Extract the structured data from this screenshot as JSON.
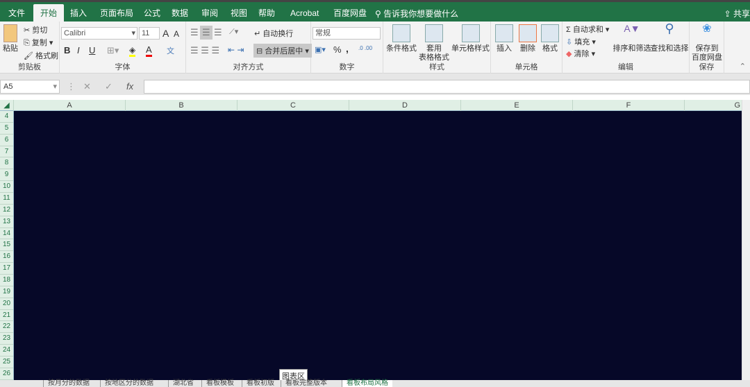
{
  "menu_tabs": [
    "文件",
    "开始",
    "插入",
    "页面布局",
    "公式",
    "数据",
    "审阅",
    "视图",
    "帮助",
    "Acrobat",
    "百度网盘"
  ],
  "tell_me": "告诉我你想要做什么",
  "share": "共享",
  "clipboard": {
    "paste": "粘贴",
    "cut": "剪切",
    "copy": "复制",
    "format_painter": "格式刷",
    "label": "剪贴板"
  },
  "font": {
    "name": "Calibri",
    "size": "11",
    "bold": "B",
    "italic": "I",
    "underline": "U",
    "grow": "A",
    "shrink": "A",
    "color": "A",
    "label": "字体",
    "phonetic": "文"
  },
  "alignment": {
    "wrap": "自动换行",
    "merge": "合并后居中",
    "label": "对齐方式"
  },
  "number": {
    "format": "常规",
    "percent": "%",
    "comma": ",",
    "label": "数字"
  },
  "styles": {
    "conditional": "条件格式",
    "table": [
      "套用",
      "表格格式"
    ],
    "cell": "单元格样式",
    "label": "样式"
  },
  "cells": {
    "insert": "插入",
    "delete": "删除",
    "format": "格式",
    "label": "单元格"
  },
  "editing": {
    "autosum": "自动求和",
    "fill": "填充",
    "clear": "清除",
    "sort": "排序和筛选",
    "find": "查找和选择",
    "label": "编辑"
  },
  "save": {
    "button": [
      "保存到",
      "百度网盘"
    ],
    "label": "保存"
  },
  "formula_bar": {
    "name_box": "A5",
    "fx": "fx",
    "value": ""
  },
  "columns": [
    "A",
    "B",
    "C",
    "D",
    "E",
    "F",
    "G"
  ],
  "rows": [
    "4",
    "5",
    "6",
    "7",
    "8",
    "9",
    "10",
    "11",
    "12",
    "13",
    "14",
    "15",
    "16",
    "17",
    "18",
    "19",
    "20",
    "21",
    "22",
    "23",
    "24",
    "25",
    "26"
  ],
  "tooltip": "图表区",
  "sheet_tabs": [
    "按月分的数据",
    "按地区分的数据",
    "湖北省",
    "看板模板",
    "看板初版",
    "看板完整版本",
    "看板布局风格"
  ],
  "active_sheet": "看板布局风格",
  "colors": {
    "brand": "#217346",
    "chart_bg": "#060828"
  }
}
